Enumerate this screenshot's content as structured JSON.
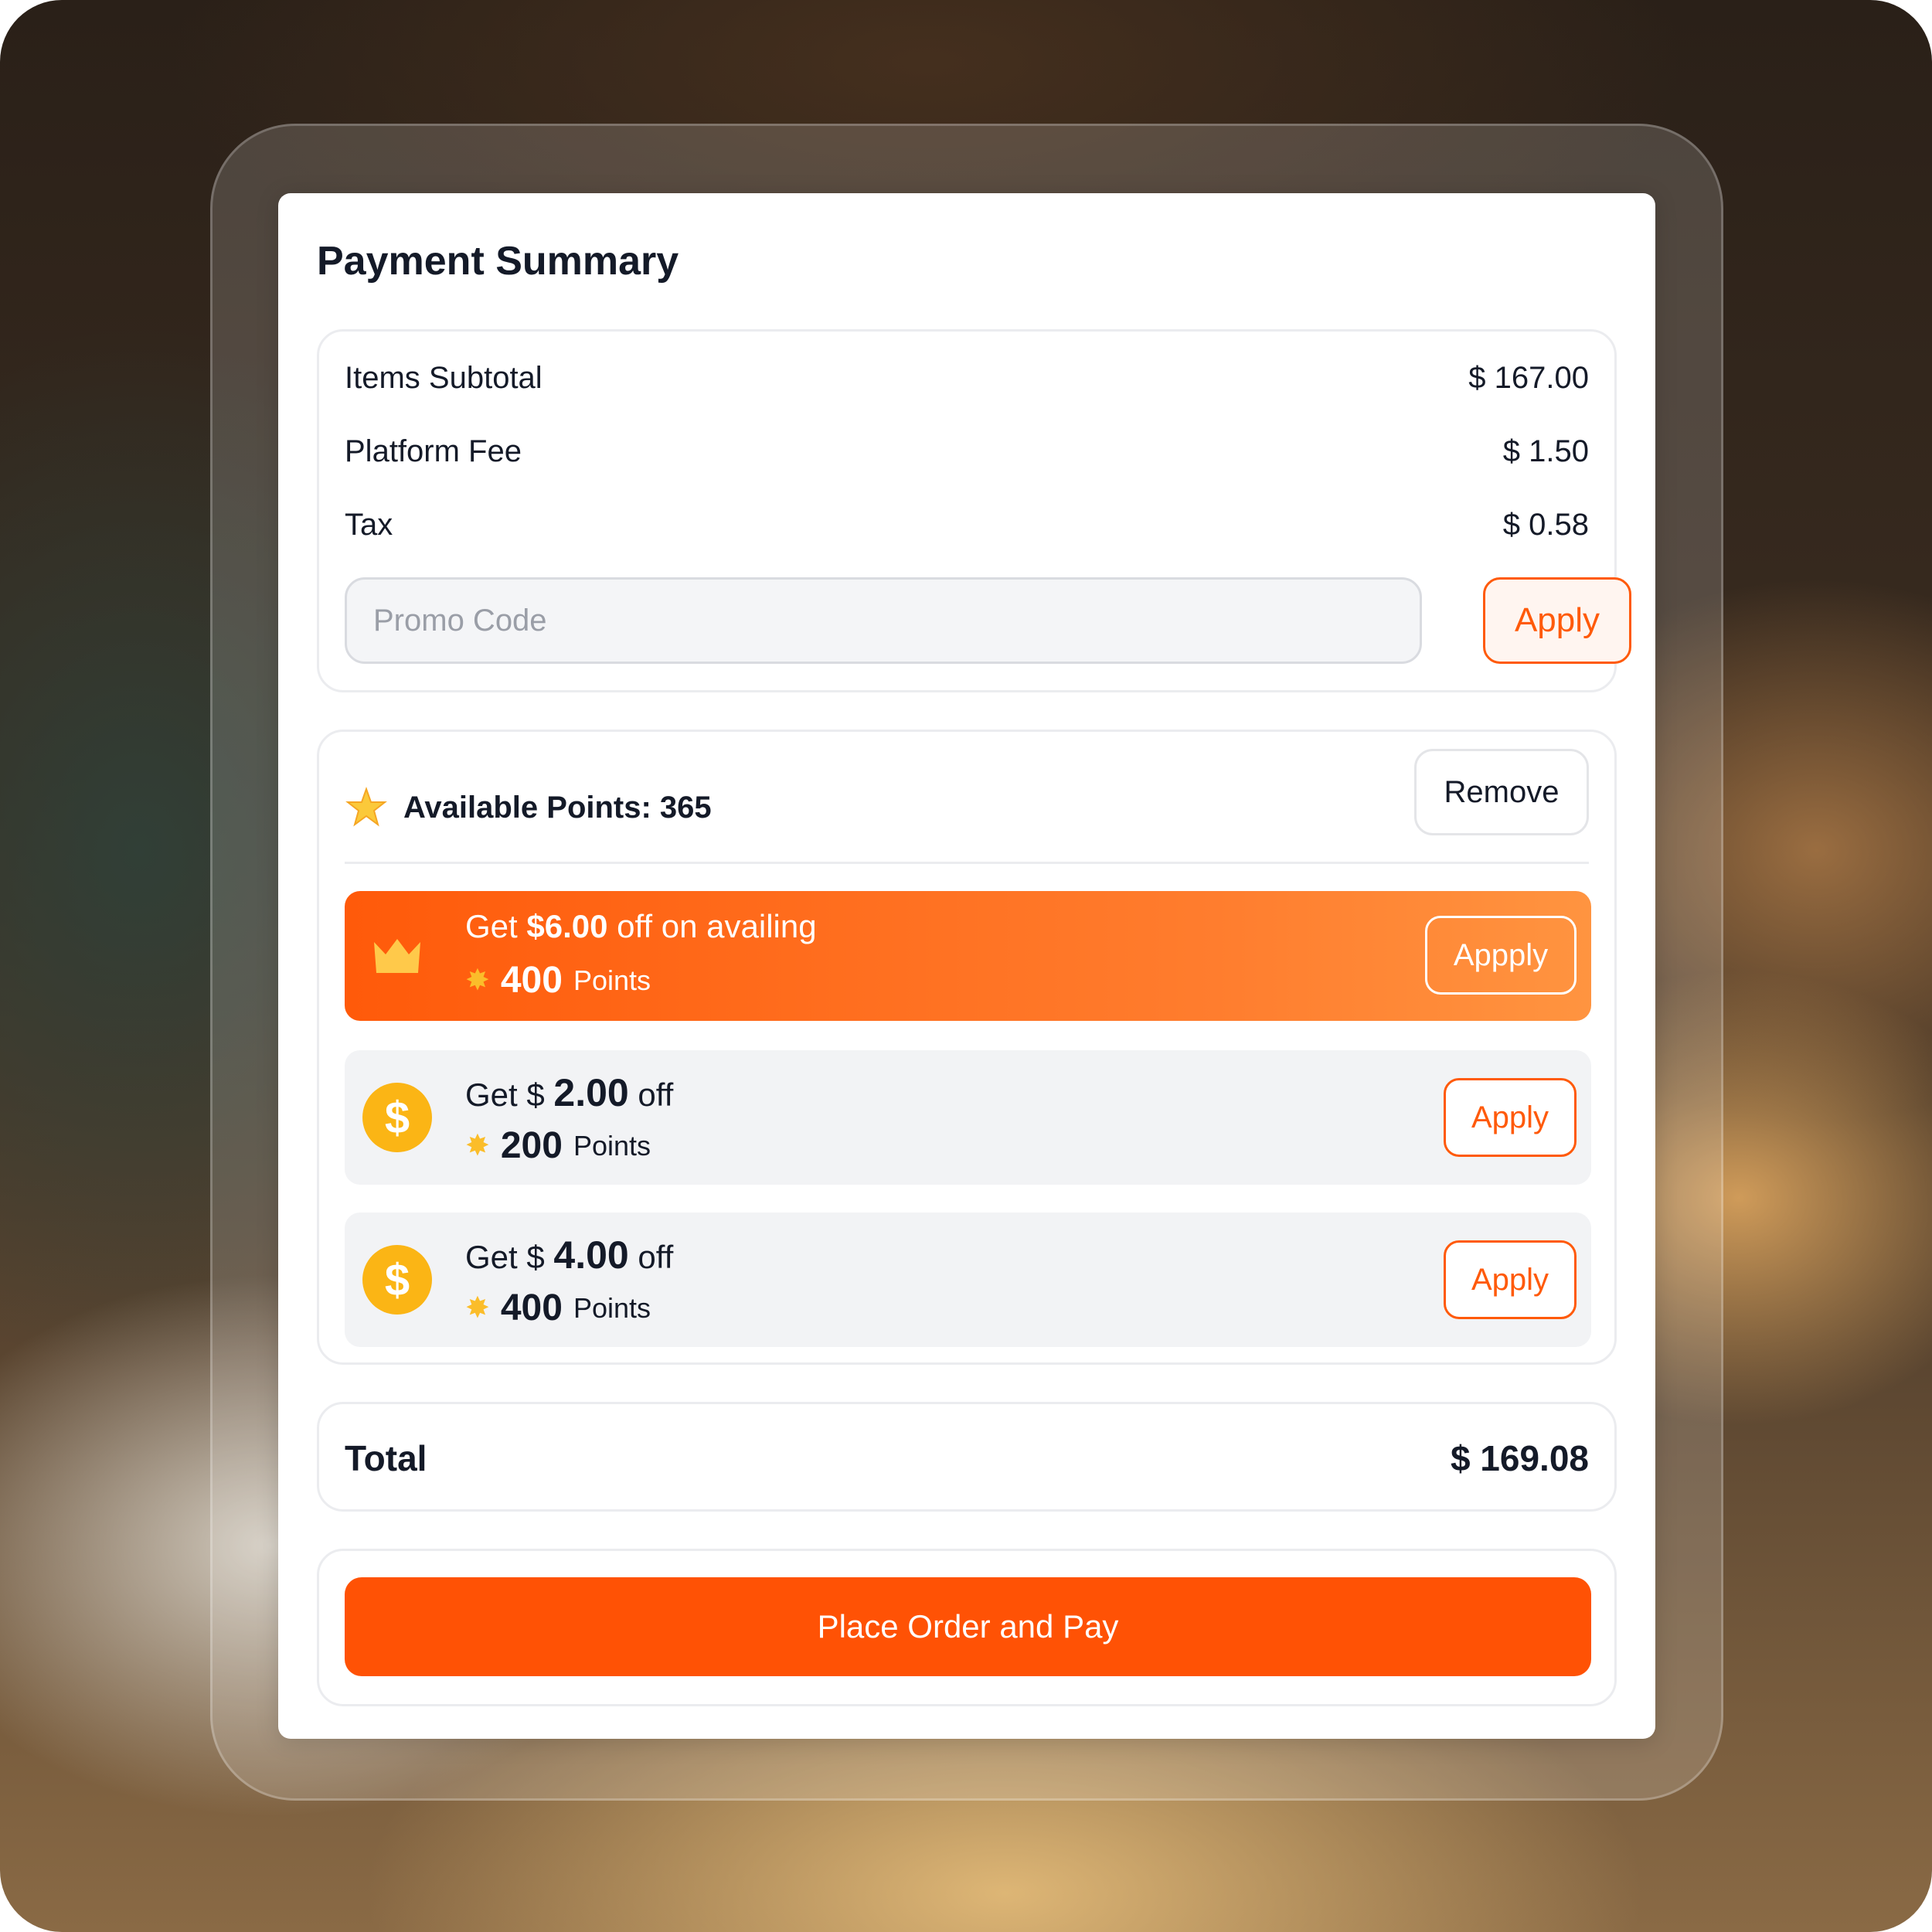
{
  "title": "Payment Summary",
  "summary": {
    "rows": [
      {
        "label": "Items Subtotal",
        "value": "$ 167.00"
      },
      {
        "label": "Platform Fee",
        "value": "$ 1.50"
      },
      {
        "label": "Tax",
        "value": "$ 0.58"
      }
    ],
    "promo_placeholder": "Promo Code",
    "promo_value": "",
    "apply_label": "Apply"
  },
  "points": {
    "icon": "star-icon",
    "label": "Available Points: 365",
    "remove_label": "Remove",
    "offers": [
      {
        "icon": "crown-icon",
        "prefix": "Get ",
        "amount": "$6.00",
        "suffix": " off on availing",
        "points": "400",
        "points_word": "Points",
        "button": "Appply",
        "highlighted": true
      },
      {
        "icon": "dollar-coin-icon",
        "prefix": "Get $ ",
        "amount": "2.00",
        "suffix": " off",
        "points": "200",
        "points_word": "Points",
        "button": "Apply",
        "highlighted": false
      },
      {
        "icon": "dollar-coin-icon",
        "prefix": "Get $ ",
        "amount": "4.00",
        "suffix": " off",
        "points": "400",
        "points_word": "Points",
        "button": "Apply",
        "highlighted": false
      }
    ]
  },
  "total": {
    "label": "Total",
    "value": "$ 169.08"
  },
  "cta_label": "Place Order and Pay",
  "colors": {
    "accent": "#ff5a0a",
    "coin": "#fbb515",
    "text": "#141a28"
  }
}
